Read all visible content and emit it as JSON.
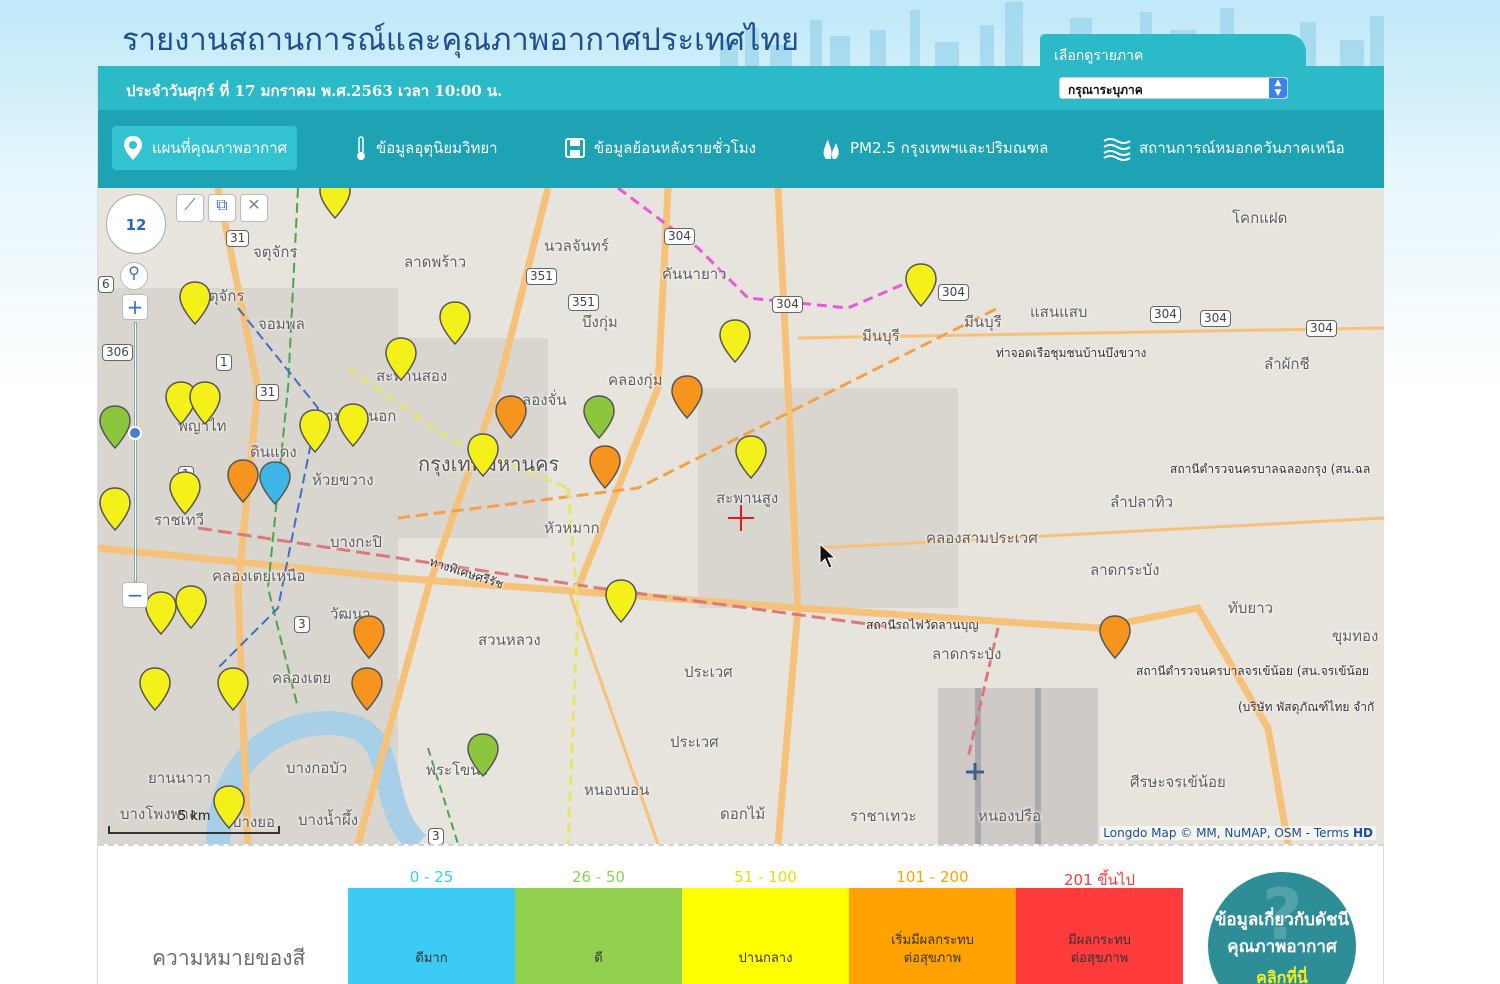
{
  "header": {
    "site_title": "รายงานสถานการณ์และคุณภาพอากาศประเทศไทย",
    "region_label": "เลือกดูรายภาค",
    "region_select_value": "กรุณาระบุภาค",
    "date_text": "ประจำวันศุกร์ ที่ 17 มกราคม พ.ศ.2563 เวลา 10:00 น."
  },
  "nav": [
    {
      "label": "แผนที่คุณภาพอากาศ",
      "icon": "map-pin-icon",
      "active": true
    },
    {
      "label": "ข้อมูลอุตุนิยมวิทยา",
      "icon": "thermometer-icon",
      "active": false
    },
    {
      "label": "ข้อมูลย้อนหลังรายชั่วโมง",
      "icon": "save-disk-icon",
      "active": false
    },
    {
      "label": "PM2.5 กรุงเทพฯและปริมณฑล",
      "icon": "flame-icon",
      "active": false
    },
    {
      "label": "สถานการณ์หมอกควันภาคเหนือ",
      "icon": "haze-waves-icon",
      "active": false
    }
  ],
  "map": {
    "zoom_level": "12",
    "scale_label": "5 km",
    "attribution": {
      "longdo": "Longdo Map",
      "copyright": "© MM, NuMAP, OSM",
      "terms": "- Terms",
      "hd": "HD"
    },
    "places": [
      {
        "text": "กรุงเทพมหานคร",
        "size": "big"
      },
      {
        "text": "จตุจักร",
        "size": "normal"
      },
      {
        "text": "จตุจักร",
        "size": "normal"
      },
      {
        "text": "ลาดพร้าว",
        "size": "normal"
      },
      {
        "text": "นวลจันทร์",
        "size": "normal"
      },
      {
        "text": "คันนายาว",
        "size": "normal"
      },
      {
        "text": "บึงกุ่ม",
        "size": "normal"
      },
      {
        "text": "มีนบุรี",
        "size": "normal"
      },
      {
        "text": "มีนบุรี",
        "size": "normal"
      },
      {
        "text": "แสนแสบ",
        "size": "normal"
      },
      {
        "text": "โคกแฝด",
        "size": "normal"
      },
      {
        "text": "ลำผักชี",
        "size": "normal"
      },
      {
        "text": "จอมพล",
        "size": "normal"
      },
      {
        "text": "สะพานสอง",
        "size": "normal"
      },
      {
        "text": "คลองจั่น",
        "size": "normal"
      },
      {
        "text": "คลองกุ่ม",
        "size": "normal"
      },
      {
        "text": "พญาไท",
        "size": "normal"
      },
      {
        "text": "สามเสนนอก",
        "size": "normal"
      },
      {
        "text": "ดินแดง",
        "size": "normal"
      },
      {
        "text": "ห้วยขวาง",
        "size": "normal"
      },
      {
        "text": "ราชเทวี",
        "size": "normal"
      },
      {
        "text": "สะพานสูง",
        "size": "normal"
      },
      {
        "text": "หัวหมาก",
        "size": "normal"
      },
      {
        "text": "บางกะปิ",
        "size": "normal"
      },
      {
        "text": "คลองเตยเหนือ",
        "size": "normal"
      },
      {
        "text": "ทางพิเศษศรีรัช",
        "size": "small"
      },
      {
        "text": "ลำปลาทิว",
        "size": "normal"
      },
      {
        "text": "คลองสามประเวศ",
        "size": "normal"
      },
      {
        "text": "ลาดกระบัง",
        "size": "normal"
      },
      {
        "text": "ลาดกระบัง",
        "size": "normal"
      },
      {
        "text": "ทับยาว",
        "size": "normal"
      },
      {
        "text": "ขุมทอง",
        "size": "normal"
      },
      {
        "text": "สวนหลวง",
        "size": "normal"
      },
      {
        "text": "วัฒนา",
        "size": "normal"
      },
      {
        "text": "ประเวศ",
        "size": "normal"
      },
      {
        "text": "ประเวศ",
        "size": "normal"
      },
      {
        "text": "คลองเตย",
        "size": "normal"
      },
      {
        "text": "ยานนาวา",
        "size": "normal"
      },
      {
        "text": "บางกอบัว",
        "size": "normal"
      },
      {
        "text": "พระโขนง",
        "size": "normal"
      },
      {
        "text": "หนองบอน",
        "size": "normal"
      },
      {
        "text": "ดอกไม้",
        "size": "normal"
      },
      {
        "text": "ราชาเทวะ",
        "size": "normal"
      },
      {
        "text": "หนองปรือ",
        "size": "normal"
      },
      {
        "text": "ศีรษะจรเข้น้อย",
        "size": "normal"
      },
      {
        "text": "บางโพงพาง",
        "size": "normal"
      },
      {
        "text": "บางยอ",
        "size": "normal"
      },
      {
        "text": "บางน้ำผึ้ง",
        "size": "normal"
      },
      {
        "text": "ท่าจอดเรือชุมชนบ้านบึงขวาง",
        "size": "small"
      },
      {
        "text": "สถานีตำรวจนครบาลฉลองกรุง (สน.ฉล",
        "size": "small"
      },
      {
        "text": "สถานีรถไฟวัดลานบุญ",
        "size": "small"
      },
      {
        "text": "สถานีตำรวจนครบาลจรเข้น้อย (สน.จรเข้น้อย",
        "size": "small"
      },
      {
        "text": "(บริษัท พัสดุภัณฑ์ไทย จำกั",
        "size": "small"
      }
    ],
    "road_shields": [
      "304",
      "351",
      "351",
      "304",
      "304",
      "304",
      "304",
      "304",
      "31",
      "31",
      "306",
      "1",
      "1",
      "3",
      "3",
      "6"
    ],
    "marker_colors": {
      "good_very": "#3fb6e8",
      "good": "#8cc63f",
      "moderate": "#f4f11a",
      "unhealthy_sensitive": "#f7941d"
    },
    "markers": [
      {
        "level": "moderate"
      },
      {
        "level": "moderate"
      },
      {
        "level": "moderate"
      },
      {
        "level": "moderate"
      },
      {
        "level": "moderate"
      },
      {
        "level": "moderate"
      },
      {
        "level": "moderate"
      },
      {
        "level": "moderate"
      },
      {
        "level": "moderate"
      },
      {
        "level": "moderate"
      },
      {
        "level": "moderate"
      },
      {
        "level": "moderate"
      },
      {
        "level": "moderate"
      },
      {
        "level": "moderate"
      },
      {
        "level": "moderate"
      },
      {
        "level": "moderate"
      },
      {
        "level": "moderate"
      },
      {
        "level": "moderate"
      },
      {
        "level": "moderate"
      },
      {
        "level": "moderate"
      },
      {
        "level": "unhealthy_sensitive"
      },
      {
        "level": "unhealthy_sensitive"
      },
      {
        "level": "unhealthy_sensitive"
      },
      {
        "level": "unhealthy_sensitive"
      },
      {
        "level": "unhealthy_sensitive"
      },
      {
        "level": "unhealthy_sensitive"
      },
      {
        "level": "unhealthy_sensitive"
      },
      {
        "level": "good"
      },
      {
        "level": "good"
      },
      {
        "level": "good"
      },
      {
        "level": "good_very"
      }
    ]
  },
  "legend": {
    "title": "ความหมายของสี",
    "ranges": [
      {
        "range": "0 - 25",
        "label": "ดีมาก",
        "color": "#3ccbf4",
        "text_color": "#3ccbf4"
      },
      {
        "range": "26 - 50",
        "label": "ดี",
        "color": "#92d050",
        "text_color": "#92d050"
      },
      {
        "range": "51 - 100",
        "label": "ปานกลาง",
        "color": "#ffff00",
        "text_color": "#e2e200"
      },
      {
        "range": "101 - 200",
        "label": "เริ่มมีผลกระทบ\nต่อสุขภาพ",
        "color": "#ffa200",
        "text_color": "#ffa200"
      },
      {
        "range": "201 ขึ้นไป",
        "label": "มีผลกระทบ\nต่อสุขภาพ",
        "color": "#ff3b3b",
        "text_color": "#ff3b3b"
      }
    ],
    "info_button": "ข้อมูลเกี่ยวกับดัชนีคุณภาพอากาศ",
    "info_button_extra": "คลิกที่นี่"
  }
}
